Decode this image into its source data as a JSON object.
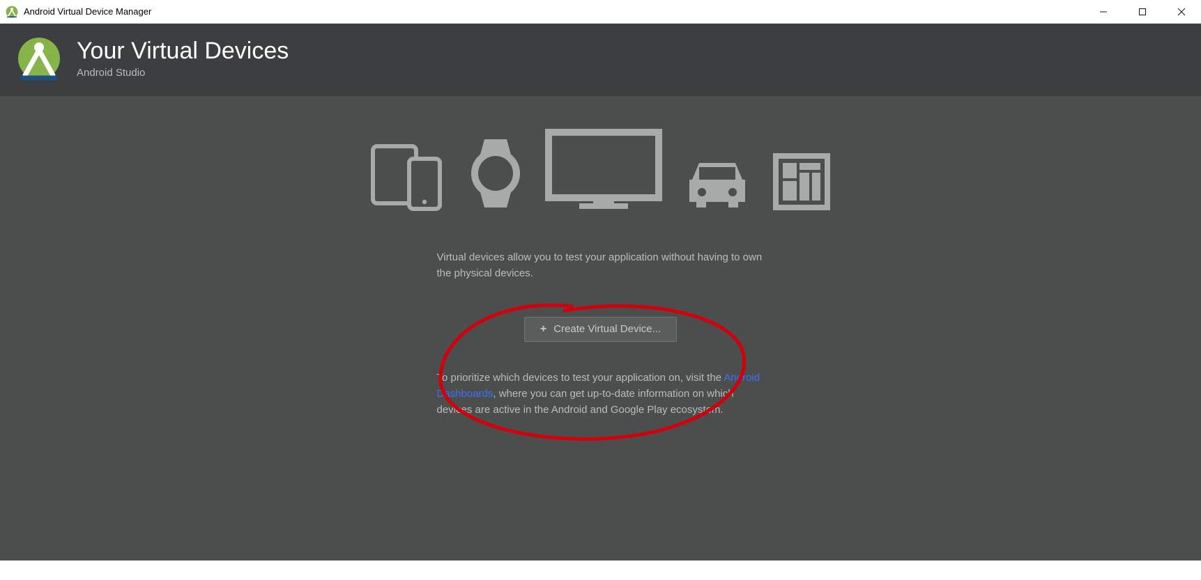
{
  "window": {
    "title": "Android Virtual Device Manager"
  },
  "header": {
    "heading": "Your Virtual Devices",
    "subtitle": "Android Studio"
  },
  "content": {
    "intro_text": "Virtual devices allow you to test your application without having to own the physical devices.",
    "create_button_label": "Create Virtual Device...",
    "info_prefix": "To prioritize which devices to test your application on, visit the ",
    "info_link": "Android Dashboards",
    "info_suffix": ", where you can get up-to-date information on which devices are active in the Android and Google Play ecosystem."
  },
  "colors": {
    "header_bg": "#3c3e3f",
    "content_bg": "#4c4e4e",
    "icon_fill": "#a7aaa9",
    "annotation": "#d3000b"
  }
}
